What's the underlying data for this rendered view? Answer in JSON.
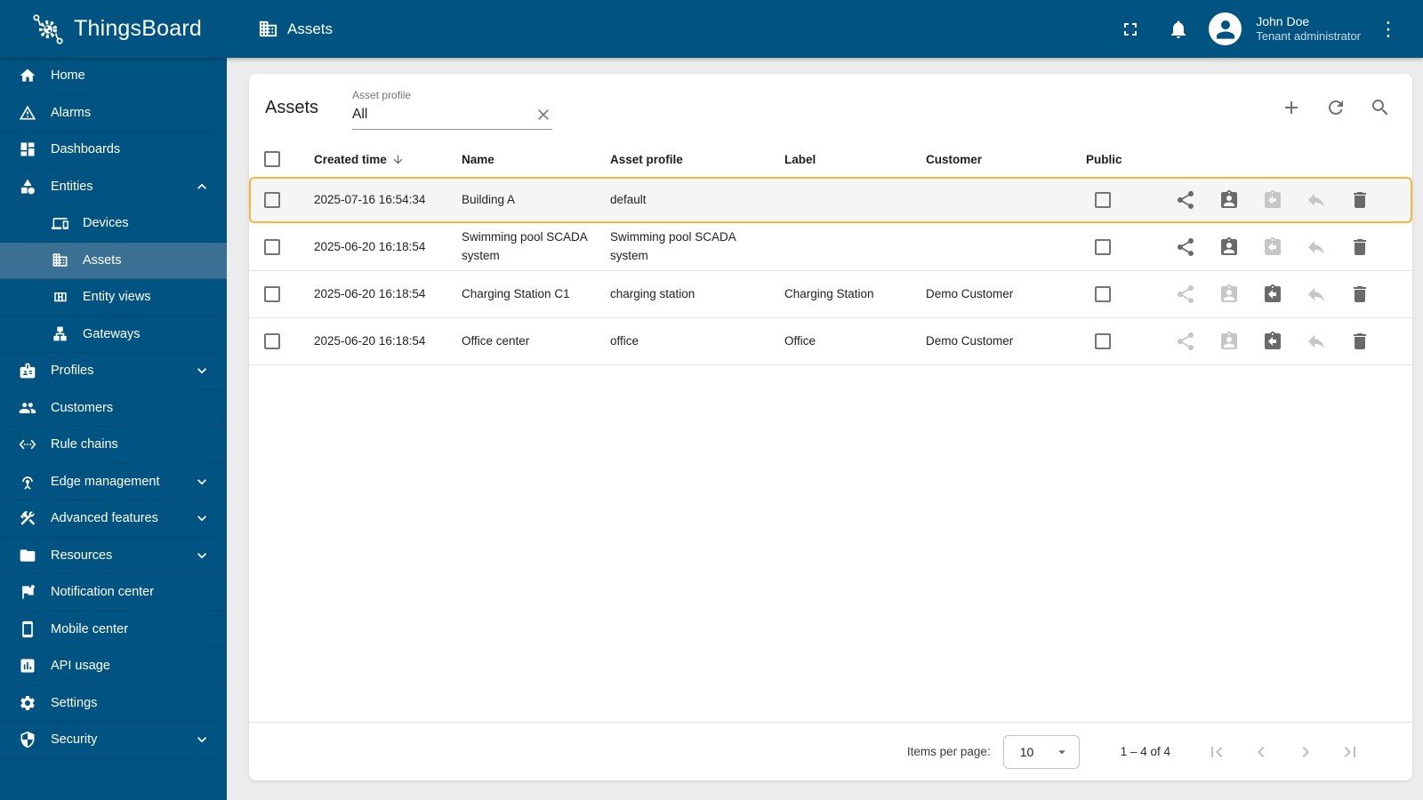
{
  "app": {
    "title": "ThingsBoard"
  },
  "topbar": {
    "page_title": "Assets",
    "user_name": "John Doe",
    "user_role": "Tenant administrator"
  },
  "sidebar": {
    "items": [
      {
        "label": "Home"
      },
      {
        "label": "Alarms"
      },
      {
        "label": "Dashboards"
      },
      {
        "label": "Entities",
        "expanded": true
      },
      {
        "label": "Devices"
      },
      {
        "label": "Assets",
        "active": true
      },
      {
        "label": "Entity views"
      },
      {
        "label": "Gateways"
      },
      {
        "label": "Profiles",
        "expandable": true
      },
      {
        "label": "Customers"
      },
      {
        "label": "Rule chains"
      },
      {
        "label": "Edge management",
        "expandable": true
      },
      {
        "label": "Advanced features",
        "expandable": true
      },
      {
        "label": "Resources",
        "expandable": true
      },
      {
        "label": "Notification center"
      },
      {
        "label": "Mobile center"
      },
      {
        "label": "API usage"
      },
      {
        "label": "Settings"
      },
      {
        "label": "Security",
        "expandable": true
      }
    ]
  },
  "page": {
    "title": "Assets",
    "filter": {
      "label": "Asset profile",
      "value": "All"
    },
    "table": {
      "columns": {
        "created": "Created time",
        "name": "Name",
        "profile": "Asset profile",
        "label": "Label",
        "customer": "Customer",
        "public": "Public"
      },
      "rows": [
        {
          "created_time": "2025-07-16 16:54:34",
          "name": "Building A",
          "asset_profile": "default",
          "label": "",
          "customer": "",
          "public": false,
          "assigned_to_customer": false,
          "highlighted": true
        },
        {
          "created_time": "2025-06-20 16:18:54",
          "name": "Swimming pool SCADA system",
          "asset_profile": "Swimming pool SCADA system",
          "label": "",
          "customer": "",
          "public": false,
          "assigned_to_customer": false,
          "highlighted": false
        },
        {
          "created_time": "2025-06-20 16:18:54",
          "name": "Charging Station C1",
          "asset_profile": "charging station",
          "label": "Charging Station",
          "customer": "Demo Customer",
          "public": false,
          "assigned_to_customer": true,
          "highlighted": false
        },
        {
          "created_time": "2025-06-20 16:18:54",
          "name": "Office center",
          "asset_profile": "office",
          "label": "Office",
          "customer": "Demo Customer",
          "public": false,
          "assigned_to_customer": true,
          "highlighted": false
        }
      ]
    },
    "pagination": {
      "items_per_page_label": "Items per page:",
      "items_per_page_value": "10",
      "range_label": "1 – 4 of 4"
    }
  },
  "colors": {
    "primary": "#015482",
    "sidebar_active_bg": "#3A7094",
    "row_highlight_border": "#F3B73F"
  }
}
